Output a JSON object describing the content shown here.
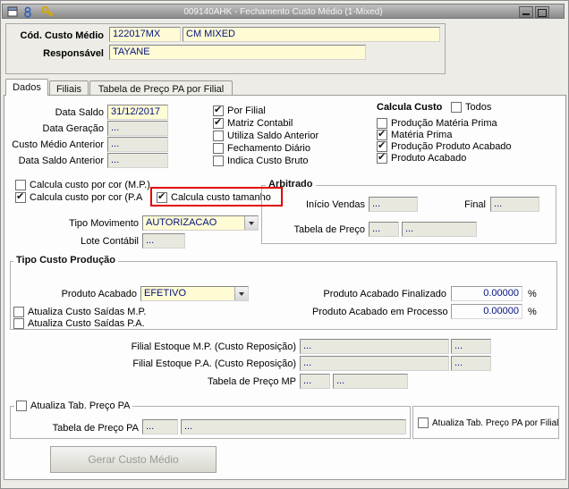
{
  "window": {
    "title": "009140AHK - Fechamento Custo Médio (1-Mixed)",
    "titlebar_icons": [
      "form-icon",
      "paragraph-icon",
      "key-icon"
    ],
    "controls": [
      "minimize-button",
      "maximize-button"
    ]
  },
  "header": {
    "cod_label": "Cód. Custo Médio",
    "cod_value": "122017MX",
    "cod_desc": "CM MIXED",
    "resp_label": "Responsável",
    "resp_value": "TAYANE"
  },
  "tabs": [
    {
      "label": "Dados",
      "active": true
    },
    {
      "label": "Filiais",
      "active": false
    },
    {
      "label": "Tabela de Preço PA por Filial",
      "active": false
    }
  ],
  "dates": {
    "data_saldo_label": "Data Saldo",
    "data_saldo_value": "31/12/2017",
    "data_geracao_label": "Data Geração",
    "data_geracao_value": "...",
    "custo_medio_anterior_label": "Custo Médio Anterior",
    "custo_medio_anterior_value": "...",
    "data_saldo_anterior_label": "Data Saldo Anterior",
    "data_saldo_anterior_value": "..."
  },
  "flags": [
    {
      "label": "Por Filial",
      "checked": true
    },
    {
      "label": "Matriz Contabil",
      "checked": true
    },
    {
      "label": "Utiliza Saldo Anterior",
      "checked": false
    },
    {
      "label": "Fechamento Diário",
      "checked": false
    },
    {
      "label": "Indica Custo Bruto",
      "checked": false
    }
  ],
  "calcula_custo": {
    "title": "Calcula Custo",
    "todos": {
      "label": "Todos",
      "checked": false
    },
    "items": [
      {
        "label": "Produção Matéria Prima",
        "checked": false
      },
      {
        "label": "Matéria Prima",
        "checked": true
      },
      {
        "label": "Produção Produto Acabado",
        "checked": true
      },
      {
        "label": "Produto Acabado",
        "checked": true
      }
    ]
  },
  "cor": {
    "mp": {
      "label": "Calcula custo por cor (M.P.)",
      "checked": false
    },
    "pa": {
      "label": "Calcula custo por cor (P.A",
      "checked": true
    },
    "tamanho": {
      "label": "Calcula custo tamanho",
      "checked": true
    }
  },
  "movimento": {
    "tipo_label": "Tipo Movimento",
    "tipo_value": "AUTORIZACAO",
    "lote_label": "Lote Contábil",
    "lote_value": "..."
  },
  "arbitrado": {
    "title": "Arbitrado",
    "inicio_label": "Início Vendas",
    "inicio_value": "...",
    "final_label": "Final",
    "final_value": "...",
    "tabela_label": "Tabela de Preço",
    "tabela_code": "...",
    "tabela_desc": "..."
  },
  "tipo_custo": {
    "title": "Tipo Custo Produção",
    "produto_label": "Produto Acabado",
    "produto_value": "EFETIVO",
    "atualiza_mp": {
      "label": "Atualiza Custo Saídas M.P.",
      "checked": false
    },
    "atualiza_pa": {
      "label": "Atualiza Custo Saídas P.A.",
      "checked": false
    },
    "finalizado_label": "Produto Acabado Finalizado",
    "finalizado_value": "0.00000",
    "processo_label": "Produto Acabado em Processo",
    "processo_value": "0.00000",
    "percent": "%"
  },
  "filiais": {
    "mp_label": "Filial Estoque M.P. (Custo Reposição)",
    "mp_value": "...",
    "mp_code": "...",
    "pa_label": "Filial Estoque P.A. (Custo Reposição)",
    "pa_value": "...",
    "pa_code": "...",
    "tabela_mp_label": "Tabela de Preço MP",
    "tabela_mp_code": "...",
    "tabela_mp_desc": "..."
  },
  "tab_preco": {
    "atualiza": {
      "label": "Atualiza Tab. Preço PA",
      "checked": false
    },
    "tabela_label": "Tabela de Preço PA",
    "tabela_code": "...",
    "tabela_desc": "...",
    "por_filial": {
      "label": "Atualiza Tab. Preço PA por Filial",
      "checked": false
    }
  },
  "actions": {
    "gerar_label": "Gerar Custo Médio"
  },
  "colors": {
    "highlight": "#e00000",
    "field_yellow": "#fffbd4",
    "field_gray": "#e9e8df",
    "value_text": "#00127f"
  }
}
